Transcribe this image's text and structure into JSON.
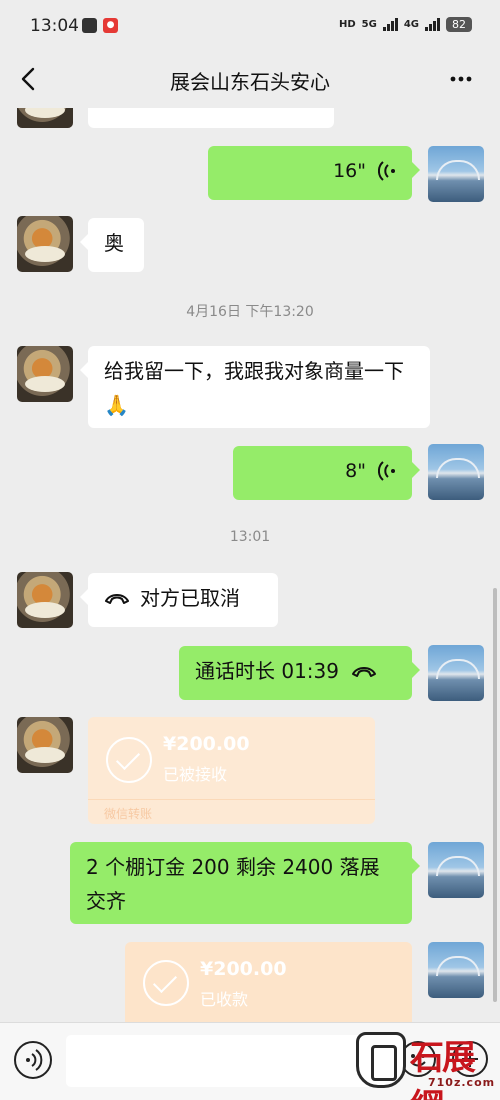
{
  "status_bar": {
    "time": "13:04",
    "network_hd": "HD",
    "network_5g": "5G",
    "network_4g": "4G",
    "battery": "82"
  },
  "header": {
    "title": "展会山东石头安心",
    "back_icon": "chevron-left-icon",
    "more_icon": "more-dots-icon"
  },
  "messages": {
    "voice1": {
      "duration": "16\""
    },
    "text1": {
      "text": "奥"
    },
    "timestamp1": "4月16日 下午13:20",
    "text2": {
      "text": "给我留一下，我跟我对象商量一下🙏"
    },
    "voice2": {
      "duration": "8\""
    },
    "timestamp2": "13:01",
    "call_cancel": {
      "text": "对方已取消"
    },
    "call_duration": {
      "text": "通话时长 01:39"
    },
    "transfer1": {
      "amount": "¥200.00",
      "status": "已被接收",
      "footer": "微信转账"
    },
    "text3": {
      "text": "2 个棚订金 200 剩余 2400 落展交齐"
    },
    "transfer2": {
      "amount": "¥200.00",
      "status": "已收款"
    }
  },
  "watermark": {
    "text": "石展網",
    "sub": "710z.com"
  },
  "colors": {
    "outgoing_bubble": "#95ec69",
    "incoming_bubble": "#ffffff",
    "transfer_card": "#fde4ca",
    "background": "#ededed"
  }
}
